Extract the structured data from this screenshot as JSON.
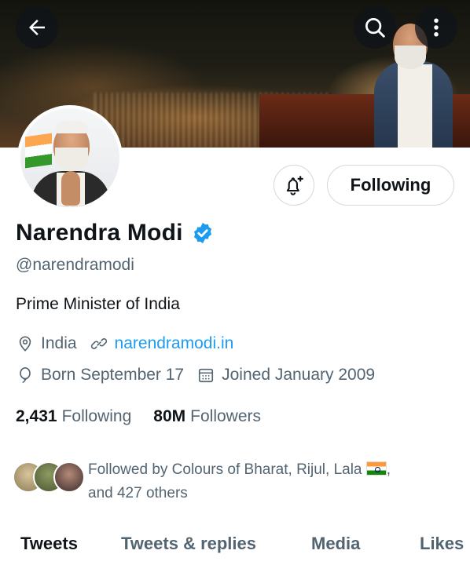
{
  "header": {
    "back_icon": "arrow-left-icon",
    "search_icon": "search-icon",
    "more_icon": "more-vertical-icon"
  },
  "profile": {
    "name": "Narendra Modi",
    "verified": true,
    "handle": "@narendramodi",
    "bio": "Prime Minister of India",
    "location": "India",
    "website": "narendramodi.in",
    "born": "Born September 17",
    "joined": "Joined January 2009"
  },
  "actions": {
    "follow_label": "Following",
    "notify_icon": "bell-plus-icon"
  },
  "counts": {
    "following_value": "2,431",
    "following_label": "Following",
    "followers_value": "80M",
    "followers_label": "Followers"
  },
  "followed_by": {
    "line1": "Followed by Colours of Bharat, Rijul, Lala",
    "line1_suffix": ",",
    "line2": "and 427 others"
  },
  "tabs": [
    {
      "label": "Tweets",
      "active": true
    },
    {
      "label": "Tweets & replies",
      "active": false
    },
    {
      "label": "Media",
      "active": false
    },
    {
      "label": "Likes",
      "active": false
    }
  ],
  "colors": {
    "accent": "#1d9bf0",
    "text": "#0f1419",
    "secondary": "#536471"
  }
}
